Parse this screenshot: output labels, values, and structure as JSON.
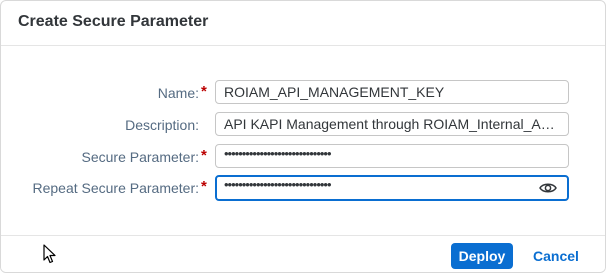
{
  "dialog": {
    "title": "Create Secure Parameter"
  },
  "form": {
    "fields": [
      {
        "label": "Name:",
        "required": true,
        "value": "ROIAM_API_MANAGEMENT_KEY"
      },
      {
        "label": "Description:",
        "required": false,
        "value": "API KAPI Management through ROIAM_Internal_Ap..."
      },
      {
        "label": "Secure Parameter:",
        "required": true,
        "value": "••••••••••••••••••••••••••••••"
      },
      {
        "label": "Repeat Secure Parameter:",
        "required": true,
        "value": "••••••••••••••••••••••••••••••"
      }
    ],
    "required_marker": "*"
  },
  "footer": {
    "deploy_label": "Deploy",
    "cancel_label": "Cancel"
  },
  "icons": {
    "show_password": "eye-icon",
    "cursor": "mouse-pointer-icon"
  },
  "colors": {
    "accent": "#0a6ed1",
    "required": "#bb0000",
    "label": "#556b82"
  }
}
